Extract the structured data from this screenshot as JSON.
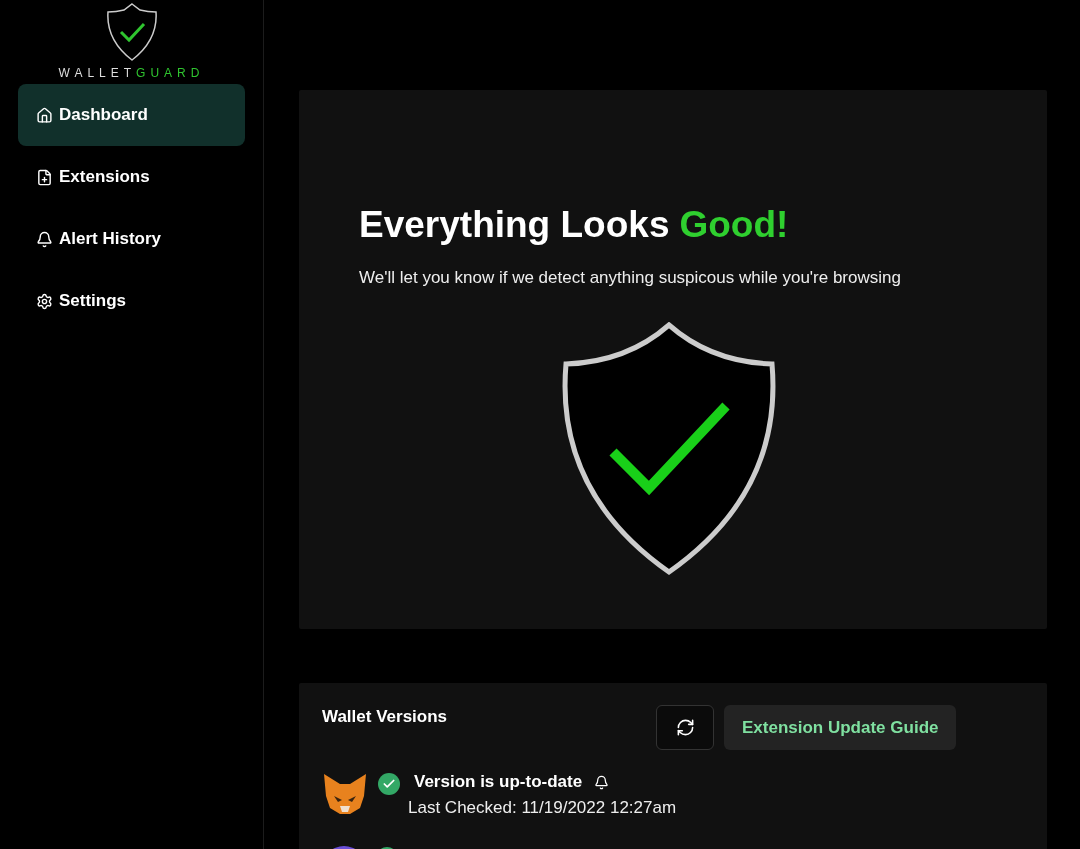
{
  "logo": {
    "word_1": "WALLET",
    "word_2": "GUARD"
  },
  "nav": [
    {
      "label": "Dashboard",
      "kind": "home",
      "selected": true
    },
    {
      "label": "Extensions",
      "kind": "file",
      "selected": false
    },
    {
      "label": "Alert History",
      "kind": "bell",
      "selected": false
    },
    {
      "label": "Settings",
      "kind": "gear",
      "selected": false
    }
  ],
  "status_panel": {
    "title": "Everything Looks",
    "title_accent": "Good!",
    "message": "We'll let you know if we detect anything suspicous while you're browsing"
  },
  "versions_panel": {
    "title": "Wallet Versions",
    "guide_button": "Extension Update Guide",
    "wallets": [
      {
        "kind": "fox",
        "up_to_date": true,
        "message": "Version is up-to-date",
        "last_checked": "Last Checked: 11/19/2022 12:27am"
      },
      {
        "kind": "circle",
        "up_to_date": true
      }
    ]
  }
}
